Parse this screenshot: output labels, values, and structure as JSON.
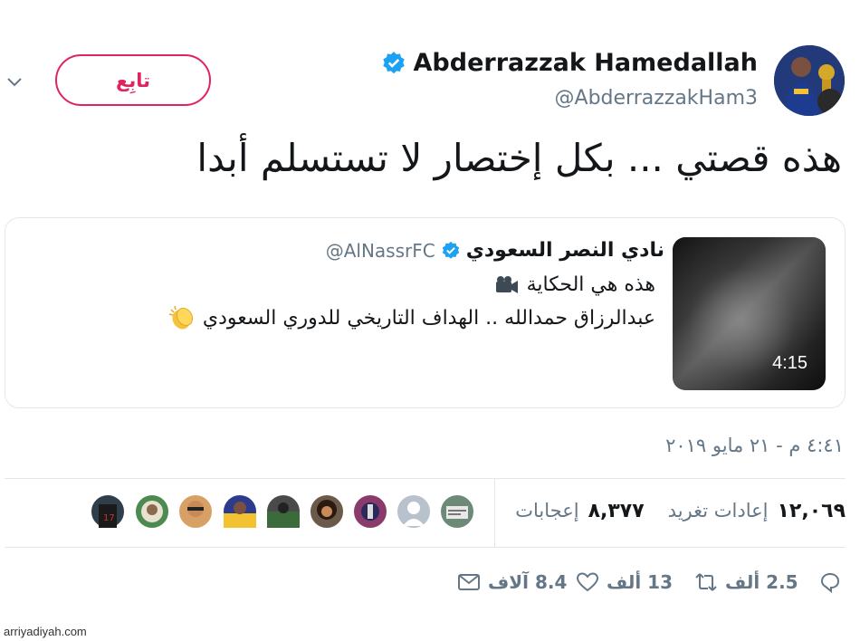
{
  "header": {
    "follow_label": "تابِع",
    "display_name": "Abderrazzak Hamedallah",
    "handle": "@AbderrazzakHam3",
    "icons": {
      "menu": "chevron-down-icon",
      "verified": "verified-badge-icon"
    }
  },
  "tweet": {
    "text": "هذه قصتي ... بكل إختصار لا تستسلم أبدا",
    "timestamp": "٤:٤١ م - ٢١ مايو ٢٠١٩"
  },
  "quoted": {
    "name": "نادي النصر السعودي",
    "handle": "@AlNassrFC",
    "line1": "هذه هي الحكاية",
    "line1_icon": "video-camera-emoji",
    "line2": "عبدالرزاق حمدالله .. الهداف التاريخي للدوري السعودي",
    "line2_icon": "clapping-hands-emoji",
    "video_duration": "4:15"
  },
  "stats": {
    "retweets_count": "١٢,٠٦٩",
    "retweets_label": "إعادات تغريد",
    "likes_count": "٨,٣٧٧",
    "likes_label": "إعجابات"
  },
  "likers": [
    {
      "name": "liker-avatar-1",
      "color": "#2f3e4b"
    },
    {
      "name": "liker-avatar-2",
      "color": "#4d8a4f"
    },
    {
      "name": "liker-avatar-3",
      "color": "#d9a066"
    },
    {
      "name": "liker-avatar-4",
      "color": "#2c3b8c"
    },
    {
      "name": "liker-avatar-5",
      "color": "#4a4a4a"
    },
    {
      "name": "liker-avatar-6",
      "color": "#6b5a4a"
    },
    {
      "name": "liker-avatar-7",
      "color": "#8a3b6b"
    },
    {
      "name": "liker-avatar-8",
      "color": "#b8c2cc"
    },
    {
      "name": "liker-avatar-9",
      "color": "#6d8a78"
    }
  ],
  "actions": {
    "reply_count": "2.5 ألف",
    "retweet_count": "13 ألف",
    "like_count": "8.4 آلاف"
  },
  "colors": {
    "accent": "#e0245e",
    "verified": "#1da1f2",
    "muted": "#657786"
  },
  "watermark": "arriyadiyah.com"
}
